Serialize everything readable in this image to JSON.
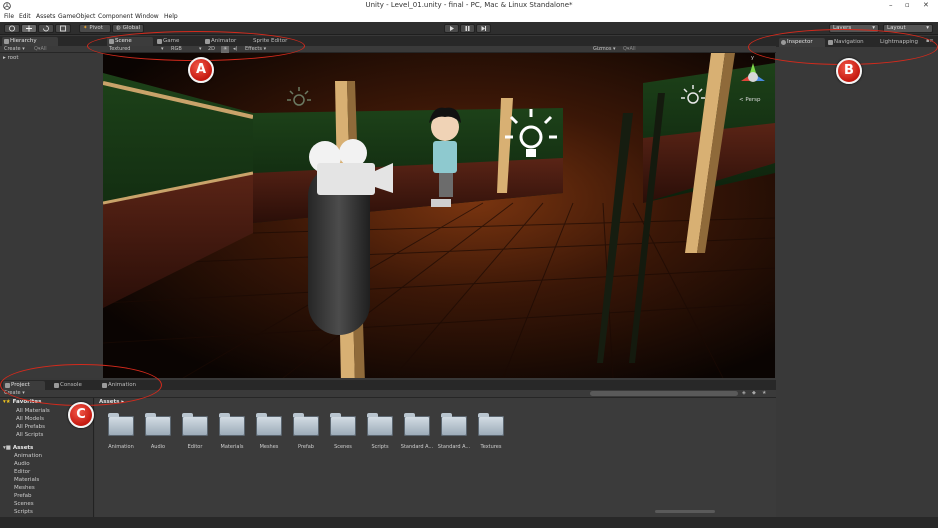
{
  "window": {
    "title": "Unity - Level_01.unity - final - PC, Mac & Linux Standalone*",
    "controls": [
      "–",
      "▫",
      "✕"
    ]
  },
  "menu": [
    "File",
    "Edit",
    "Assets",
    "GameObject",
    "Component",
    "Window",
    "Help"
  ],
  "toolbar": {
    "pivot": "Pivot",
    "global": "Global",
    "layers": "Layers",
    "layout": "Layout"
  },
  "hierarchy": {
    "tab": "Hierarchy",
    "create": "Create ▾",
    "search": "Q▾All",
    "root": "▸ root"
  },
  "scene_tabs": [
    "Scene",
    "Game",
    "Animator",
    "Sprite Editor"
  ],
  "scene_bar": {
    "shading": "Textured",
    "rgb": "RGB",
    "mode2d": "2D",
    "effects": "Effects ▾",
    "gizmos": "Gizmos ▾",
    "search": "Q▾All",
    "persp": "< Persp",
    "gizmo_y": "y"
  },
  "inspector_tabs": [
    "Inspector",
    "Navigation",
    "Lightmapping"
  ],
  "bottom_tabs": [
    "Project",
    "Console",
    "Animation"
  ],
  "project": {
    "create": "Create ▾",
    "favorites": {
      "header": "Favorites",
      "items": [
        "All Materials",
        "All Models",
        "All Prefabs",
        "All Scripts"
      ]
    },
    "assets": {
      "header": "Assets",
      "items": [
        "Animation",
        "Audio",
        "Editor",
        "Materials",
        "Meshes",
        "Prefab",
        "Scenes",
        "Scripts"
      ]
    },
    "breadcrumb": "Assets ▸",
    "folders": [
      "Animation",
      "Audio",
      "Editor",
      "Materials",
      "Meshes",
      "Prefab",
      "Scenes",
      "Scripts",
      "Standard A...",
      "Standard A...",
      "Textures"
    ]
  },
  "callouts": [
    "A",
    "B",
    "C"
  ],
  "colors": {
    "callout": "#d42a1c",
    "panel": "#383838",
    "toolbar": "#2e2e2e"
  }
}
